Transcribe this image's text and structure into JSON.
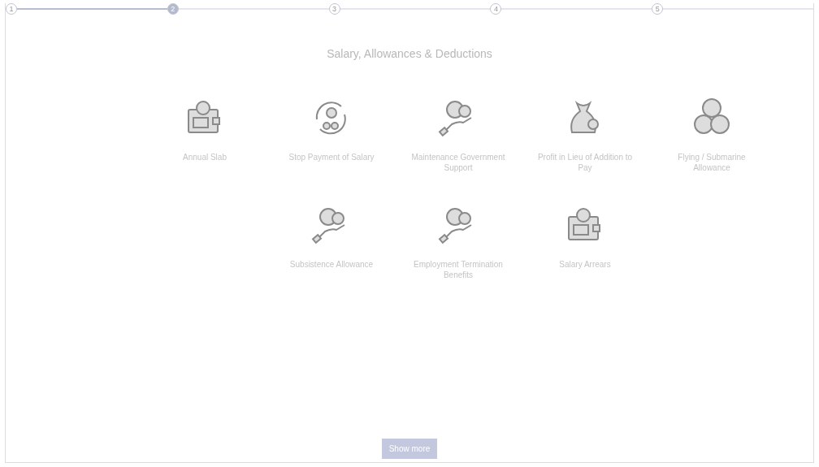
{
  "stepper": {
    "steps": [
      {
        "label": "1",
        "selected": false
      },
      {
        "label": "2",
        "selected": true
      },
      {
        "label": "3",
        "selected": false
      },
      {
        "label": "4",
        "selected": false
      },
      {
        "label": "5",
        "selected": false
      }
    ]
  },
  "title": "Salary, Allowances & Deductions",
  "items": [
    {
      "kind": "wallet",
      "label": "Annual Slab"
    },
    {
      "kind": "scissors",
      "label": "Stop Payment of Salary"
    },
    {
      "kind": "hand",
      "label": "Maintenance Government Support"
    },
    {
      "kind": "bag",
      "label": "Profit in Lieu of Addition to Pay"
    },
    {
      "kind": "coins",
      "label": "Flying / Submarine Allowance"
    },
    {
      "kind": "hand",
      "label": "Subsistence Allowance"
    },
    {
      "kind": "hand",
      "label": "Employment Termination Benefits"
    },
    {
      "kind": "wallet",
      "label": "Salary Arrears"
    }
  ],
  "button": "Show more"
}
